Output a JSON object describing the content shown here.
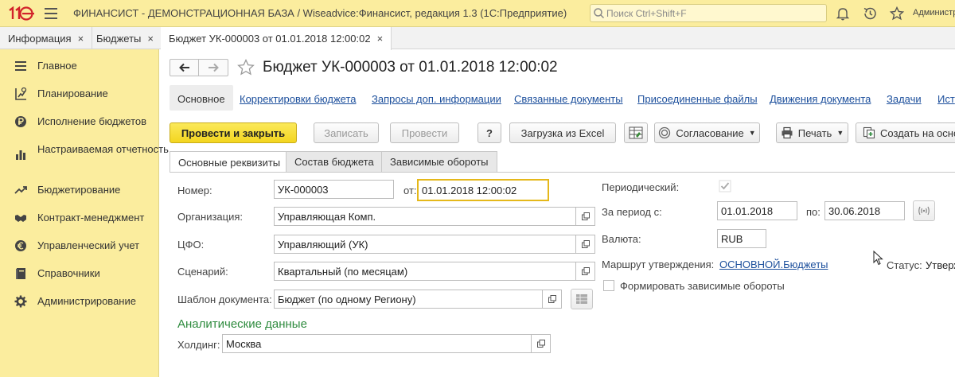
{
  "topbar": {
    "logo_text": "1С",
    "title": "ФИНАНСИСТ - ДЕМОНСТРАЦИОННАЯ БАЗА / Wiseadvice:Финансист, редакция 1.3  (1С:Предприятие)",
    "search_placeholder": "Поиск Ctrl+Shift+F",
    "user": "Администр"
  },
  "window_tabs": [
    {
      "label": "Информация",
      "close": "×"
    },
    {
      "label": "Бюджеты",
      "close": "×"
    },
    {
      "label": "Бюджет УК-000003 от 01.01.2018 12:00:02",
      "close": "×"
    }
  ],
  "sidebar": {
    "items": [
      {
        "label": "Главное",
        "icon": "menu-lines-icon"
      },
      {
        "label": "Планирование",
        "icon": "planning-icon"
      },
      {
        "label": "Исполнение бюджетов",
        "icon": "ruble-icon"
      },
      {
        "label": "Настраиваемая отчетность",
        "icon": "bar-chart-icon"
      },
      {
        "label": "Бюджетирование",
        "icon": "trend-icon"
      },
      {
        "label": "Контракт-менеджмент",
        "icon": "handshake-icon"
      },
      {
        "label": "Управленческий учет",
        "icon": "euro-icon"
      },
      {
        "label": "Справочники",
        "icon": "book-icon"
      },
      {
        "label": "Администрирование",
        "icon": "gear-icon"
      }
    ]
  },
  "document": {
    "title": "Бюджет УК-000003 от 01.01.2018 12:00:02",
    "links": [
      "Основное",
      "Корректировки бюджета",
      "Запросы доп. информации",
      "Связанные документы",
      "Присоединенные файлы",
      "Движения документа",
      "Задачи",
      "Ист"
    ],
    "buttons": {
      "post_close": "Провести и закрыть",
      "save": "Записать",
      "post": "Провести",
      "help": "?",
      "excel": "Загрузка из Excel",
      "approval": "Согласование",
      "print": "Печать",
      "create_based": "Создать на осно"
    },
    "form_tabs": [
      "Основные реквизиты",
      "Состав бюджета",
      "Зависимые обороты"
    ],
    "fields": {
      "number_label": "Номер:",
      "number_value": "УК-000003",
      "from_label": "от:",
      "date_value": "01.01.2018 12:00:02",
      "org_label": "Организация:",
      "org_value": "Управляющая Комп.",
      "cfo_label": "ЦФО:",
      "cfo_value": "Управляющий (УК)",
      "scenario_label": "Сценарий:",
      "scenario_value": "Квартальный (по месяцам)",
      "template_label": "Шаблон документа:",
      "template_value": "Бюджет (по одному Региону)",
      "analytics_title": "Аналитические данные",
      "holding_label": "Холдинг:",
      "holding_value": "Москва",
      "periodic_label": "Периодический:",
      "period_from_label": "За период с:",
      "period_from_value": "01.01.2018",
      "period_to_label": "по:",
      "period_to_value": "30.06.2018",
      "currency_label": "Валюта:",
      "currency_value": "RUB",
      "route_label": "Маршрут утверждения:",
      "route_value": "ОСНОВНОЙ.Бюджеты",
      "status_label": "Статус:",
      "status_value": "Утвержд",
      "dependent_label": "Формировать зависимые обороты"
    }
  },
  "colors": {
    "topbar_bg": "#fbed9e",
    "primary_button": "#f3d51f",
    "link": "#1c4f9c",
    "section_title": "#2e8b3e",
    "logo_red": "#d2232a"
  }
}
